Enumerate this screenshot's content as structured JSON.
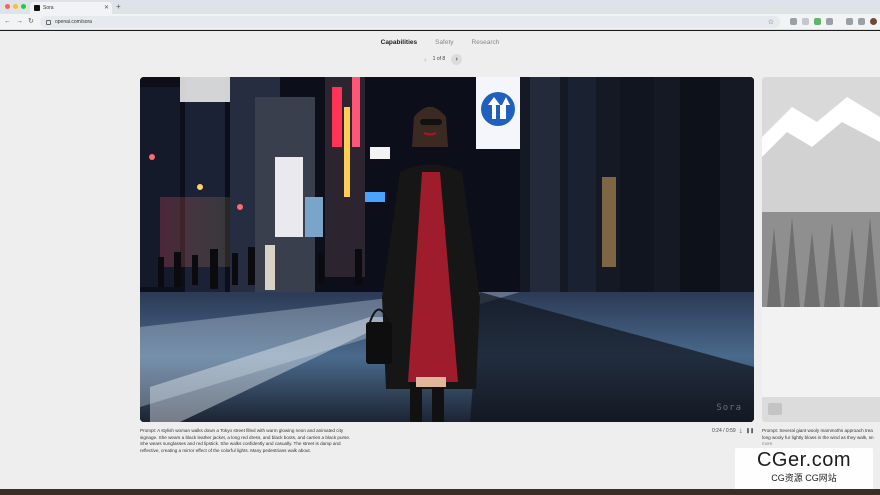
{
  "browser": {
    "tab_title": "Sora",
    "url": "openai.com/sora",
    "traffic_colors": [
      "#ff5f57",
      "#febc2e",
      "#28c840"
    ]
  },
  "subnav": {
    "tabs": [
      {
        "label": "Capabilities",
        "active": true
      },
      {
        "label": "Safety",
        "active": false
      },
      {
        "label": "Research",
        "active": false
      }
    ]
  },
  "pager": {
    "counter": "1 of 8"
  },
  "video": {
    "watermark": "Sora",
    "time": "0:24 / 0:59",
    "caption": "Prompt: A stylish woman walks down a Tokyo street filled with warm glowing neon and animated city signage. She wears a black leather jacket, a long red dress, and black boots, and carries a black purse. She wears sunglasses and red lipstick. She walks confidently and casually. The street is damp and reflective, creating a mirror effect of the colorful lights. Many pedestrians walk about."
  },
  "next_card": {
    "caption_line1": "Prompt: Several giant wooly mammoths approach trea",
    "caption_line2": "long wooly fur lightly blows in the wind as they walk, sn",
    "more": "more"
  },
  "site_mark": {
    "main": "CGer.com",
    "sub": "CG资源 CG网站"
  },
  "icons": {
    "back": "←",
    "forward": "→",
    "reload": "↻",
    "star": "☆",
    "close": "✕",
    "plus": "+",
    "chevron_left": "‹",
    "chevron_right": "›",
    "download": "⤓",
    "pause": "❚❚"
  }
}
